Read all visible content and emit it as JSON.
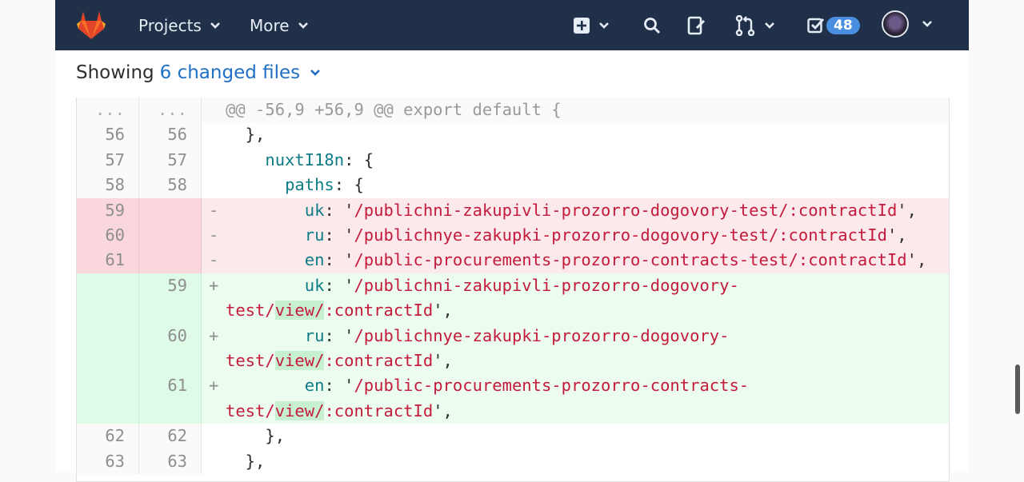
{
  "navbar": {
    "projects_label": "Projects",
    "more_label": "More",
    "todo_count": "48",
    "icons": [
      "gitlab-logo",
      "chevron-down-icon",
      "plus-square-icon",
      "search-icon",
      "issues-icon",
      "merge-request-icon",
      "todo-icon",
      "avatar"
    ],
    "bg_color": "#1f3048"
  },
  "files_header": {
    "prefix": "Showing",
    "link_text": "6 changed files"
  },
  "diff": {
    "hunk_header": "@@ -56,9 +56,9 @@ export default {",
    "rows": [
      {
        "old": "56",
        "new": "56"
      },
      {
        "old": "57",
        "new": "57"
      },
      {
        "old": "58",
        "new": "58"
      },
      {
        "old": "59",
        "new": ""
      },
      {
        "old": "60",
        "new": ""
      },
      {
        "old": "61",
        "new": ""
      },
      {
        "old": "",
        "new": "59"
      },
      {
        "old": "",
        "new": "60"
      },
      {
        "old": "",
        "new": "61"
      },
      {
        "old": "62",
        "new": "62"
      },
      {
        "old": "63",
        "new": "63"
      }
    ],
    "text": {
      "l56": "  },",
      "l57_key": "nuxtI18n",
      "l57_rest": ": {",
      "l58_key": "paths",
      "l58_rest": ": {",
      "uk": "uk",
      "ru": "ru",
      "en": "en",
      "old_uk": "/publichni-zakupivli-prozorro-dogovory-test/:contractId",
      "old_ru": "/publichnye-zakupki-prozorro-dogovory-test/:contractId",
      "old_en": "/public-procurements-prozorro-contracts-test/:contractId",
      "new_uk_1": "/publichni-zakupivli-prozorro-dogovory-",
      "new_ru_1": "/publichnye-zakupki-prozorro-dogovory-",
      "new_en_1": "/public-procurements-prozorro-contracts-",
      "test": "test/",
      "view": "view/",
      "cid": ":contractId",
      "minus": "-",
      "plus": "+",
      "l62": "    },",
      "l63": "  },"
    },
    "colors": {
      "removed_bg": "#fbe9eb",
      "added_bg": "#ecfdf0",
      "string": "#c41a3b",
      "key": "#0e7c86"
    }
  }
}
